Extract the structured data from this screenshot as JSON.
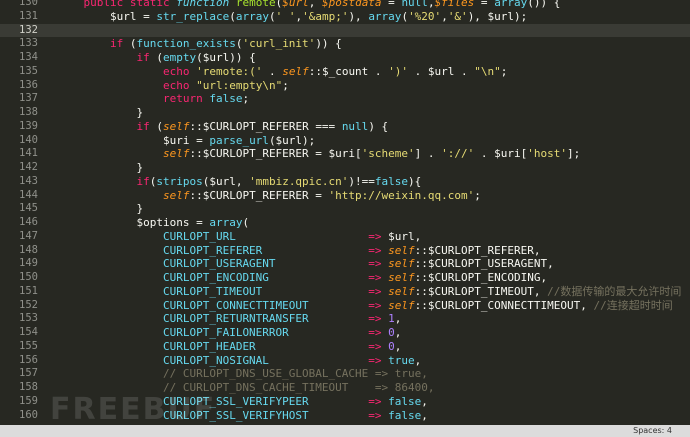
{
  "editor": {
    "lines": [
      {
        "num": "130",
        "tokens": [
          {
            "t": "    "
          },
          {
            "t": "public static ",
            "c": "kw"
          },
          {
            "t": "function ",
            "c": "st"
          },
          {
            "t": "remote",
            "c": "fn"
          },
          {
            "t": "("
          },
          {
            "t": "$url",
            "c": "var"
          },
          {
            "t": ", "
          },
          {
            "t": "$postdata",
            "c": "var"
          },
          {
            "t": " = "
          },
          {
            "t": "null",
            "c": "const"
          },
          {
            "t": ","
          },
          {
            "t": "$files",
            "c": "var"
          },
          {
            "t": " = "
          },
          {
            "t": "array",
            "c": "fb"
          },
          {
            "t": "()) {"
          }
        ]
      },
      {
        "num": "131",
        "tokens": [
          {
            "t": "        $url = "
          },
          {
            "t": "str_replace",
            "c": "fb"
          },
          {
            "t": "("
          },
          {
            "t": "array",
            "c": "fb"
          },
          {
            "t": "("
          },
          {
            "t": "' '",
            "c": "str"
          },
          {
            "t": ","
          },
          {
            "t": "'&amp;'",
            "c": "str"
          },
          {
            "t": "), "
          },
          {
            "t": "array",
            "c": "fb"
          },
          {
            "t": "("
          },
          {
            "t": "'%20'",
            "c": "str"
          },
          {
            "t": ","
          },
          {
            "t": "'&'",
            "c": "str"
          },
          {
            "t": "), $url);"
          }
        ]
      },
      {
        "num": "132",
        "current": true,
        "tokens": []
      },
      {
        "num": "133",
        "tokens": [
          {
            "t": "        "
          },
          {
            "t": "if",
            "c": "kw"
          },
          {
            "t": " ("
          },
          {
            "t": "function_exists",
            "c": "fb"
          },
          {
            "t": "("
          },
          {
            "t": "'curl_init'",
            "c": "str"
          },
          {
            "t": ")) {"
          }
        ]
      },
      {
        "num": "134",
        "tokens": [
          {
            "t": "            "
          },
          {
            "t": "if",
            "c": "kw"
          },
          {
            "t": " ("
          },
          {
            "t": "empty",
            "c": "fb"
          },
          {
            "t": "($url)) {"
          }
        ]
      },
      {
        "num": "135",
        "tokens": [
          {
            "t": "                "
          },
          {
            "t": "echo",
            "c": "kw"
          },
          {
            "t": " "
          },
          {
            "t": "'remote:('",
            "c": "str"
          },
          {
            "t": " . "
          },
          {
            "t": "self",
            "c": "self"
          },
          {
            "t": "::$_count . "
          },
          {
            "t": "')'",
            "c": "str"
          },
          {
            "t": " . $url . "
          },
          {
            "t": "\"\\n\"",
            "c": "str"
          },
          {
            "t": ";"
          }
        ]
      },
      {
        "num": "136",
        "tokens": [
          {
            "t": "                "
          },
          {
            "t": "echo",
            "c": "kw"
          },
          {
            "t": " "
          },
          {
            "t": "\"url:empty\\n\"",
            "c": "str"
          },
          {
            "t": ";"
          }
        ]
      },
      {
        "num": "137",
        "tokens": [
          {
            "t": "                "
          },
          {
            "t": "return",
            "c": "kw"
          },
          {
            "t": " "
          },
          {
            "t": "false",
            "c": "const"
          },
          {
            "t": ";"
          }
        ]
      },
      {
        "num": "138",
        "tokens": [
          {
            "t": "            }"
          }
        ]
      },
      {
        "num": "139",
        "tokens": [
          {
            "t": "            "
          },
          {
            "t": "if",
            "c": "kw"
          },
          {
            "t": " ("
          },
          {
            "t": "self",
            "c": "self"
          },
          {
            "t": "::$CURLOPT_REFERER === "
          },
          {
            "t": "null",
            "c": "const"
          },
          {
            "t": ") {"
          }
        ]
      },
      {
        "num": "140",
        "tokens": [
          {
            "t": "                $uri = "
          },
          {
            "t": "parse_url",
            "c": "fb"
          },
          {
            "t": "($url);"
          }
        ]
      },
      {
        "num": "141",
        "tokens": [
          {
            "t": "                "
          },
          {
            "t": "self",
            "c": "self"
          },
          {
            "t": "::$CURLOPT_REFERER = $uri["
          },
          {
            "t": "'scheme'",
            "c": "str"
          },
          {
            "t": "] . "
          },
          {
            "t": "'://'",
            "c": "str"
          },
          {
            "t": " . $uri["
          },
          {
            "t": "'host'",
            "c": "str"
          },
          {
            "t": "];"
          }
        ]
      },
      {
        "num": "142",
        "tokens": [
          {
            "t": "            }"
          }
        ]
      },
      {
        "num": "143",
        "tokens": [
          {
            "t": "            "
          },
          {
            "t": "if",
            "c": "kw"
          },
          {
            "t": "("
          },
          {
            "t": "stripos",
            "c": "fb"
          },
          {
            "t": "($url, "
          },
          {
            "t": "'mmbiz.qpic.cn'",
            "c": "str"
          },
          {
            "t": ")!=="
          },
          {
            "t": "false",
            "c": "const"
          },
          {
            "t": "){"
          }
        ]
      },
      {
        "num": "144",
        "tokens": [
          {
            "t": "                "
          },
          {
            "t": "self",
            "c": "self"
          },
          {
            "t": "::$CURLOPT_REFERER = "
          },
          {
            "t": "'http://weixin.qq.com'",
            "c": "str"
          },
          {
            "t": ";"
          }
        ]
      },
      {
        "num": "145",
        "tokens": [
          {
            "t": "            }"
          }
        ]
      },
      {
        "num": "146",
        "tokens": [
          {
            "t": "            $options = "
          },
          {
            "t": "array",
            "c": "fb"
          },
          {
            "t": "("
          }
        ]
      },
      {
        "num": "147",
        "tokens": [
          {
            "t": "                "
          },
          {
            "t": "CURLOPT_URL",
            "c": "const"
          },
          {
            "t": "                    "
          },
          {
            "t": "=>",
            "c": "op"
          },
          {
            "t": " $url,"
          }
        ]
      },
      {
        "num": "148",
        "tokens": [
          {
            "t": "                "
          },
          {
            "t": "CURLOPT_REFERER",
            "c": "const"
          },
          {
            "t": "                "
          },
          {
            "t": "=>",
            "c": "op"
          },
          {
            "t": " "
          },
          {
            "t": "self",
            "c": "self"
          },
          {
            "t": "::$CURLOPT_REFERER,"
          }
        ]
      },
      {
        "num": "149",
        "tokens": [
          {
            "t": "                "
          },
          {
            "t": "CURLOPT_USERAGENT",
            "c": "const"
          },
          {
            "t": "              "
          },
          {
            "t": "=>",
            "c": "op"
          },
          {
            "t": " "
          },
          {
            "t": "self",
            "c": "self"
          },
          {
            "t": "::$CURLOPT_USERAGENT,"
          }
        ]
      },
      {
        "num": "150",
        "tokens": [
          {
            "t": "                "
          },
          {
            "t": "CURLOPT_ENCODING",
            "c": "const"
          },
          {
            "t": "               "
          },
          {
            "t": "=>",
            "c": "op"
          },
          {
            "t": " "
          },
          {
            "t": "self",
            "c": "self"
          },
          {
            "t": "::$CURLOPT_ENCODING,"
          }
        ]
      },
      {
        "num": "151",
        "tokens": [
          {
            "t": "                "
          },
          {
            "t": "CURLOPT_TIMEOUT",
            "c": "const"
          },
          {
            "t": "                "
          },
          {
            "t": "=>",
            "c": "op"
          },
          {
            "t": " "
          },
          {
            "t": "self",
            "c": "self"
          },
          {
            "t": "::$CURLOPT_TIMEOUT, "
          },
          {
            "t": "//数据传输的最大允许时间",
            "c": "cm"
          }
        ]
      },
      {
        "num": "152",
        "tokens": [
          {
            "t": "                "
          },
          {
            "t": "CURLOPT_CONNECTTIMEOUT",
            "c": "const"
          },
          {
            "t": "         "
          },
          {
            "t": "=>",
            "c": "op"
          },
          {
            "t": " "
          },
          {
            "t": "self",
            "c": "self"
          },
          {
            "t": "::$CURLOPT_CONNECTTIMEOUT, "
          },
          {
            "t": "//连接超时时间",
            "c": "cm"
          }
        ]
      },
      {
        "num": "153",
        "tokens": [
          {
            "t": "                "
          },
          {
            "t": "CURLOPT_RETURNTRANSFER",
            "c": "const"
          },
          {
            "t": "         "
          },
          {
            "t": "=>",
            "c": "op"
          },
          {
            "t": " "
          },
          {
            "t": "1",
            "c": "num"
          },
          {
            "t": ","
          }
        ]
      },
      {
        "num": "154",
        "tokens": [
          {
            "t": "                "
          },
          {
            "t": "CURLOPT_FAILONERROR",
            "c": "const"
          },
          {
            "t": "            "
          },
          {
            "t": "=>",
            "c": "op"
          },
          {
            "t": " "
          },
          {
            "t": "0",
            "c": "num"
          },
          {
            "t": ","
          }
        ]
      },
      {
        "num": "155",
        "tokens": [
          {
            "t": "                "
          },
          {
            "t": "CURLOPT_HEADER",
            "c": "const"
          },
          {
            "t": "                 "
          },
          {
            "t": "=>",
            "c": "op"
          },
          {
            "t": " "
          },
          {
            "t": "0",
            "c": "num"
          },
          {
            "t": ","
          }
        ]
      },
      {
        "num": "156",
        "tokens": [
          {
            "t": "                "
          },
          {
            "t": "CURLOPT_NOSIGNAL",
            "c": "const"
          },
          {
            "t": "               "
          },
          {
            "t": "=>",
            "c": "op"
          },
          {
            "t": " "
          },
          {
            "t": "true",
            "c": "const"
          },
          {
            "t": ","
          }
        ]
      },
      {
        "num": "157",
        "tokens": [
          {
            "t": "                // CURLOPT_DNS_USE_GLOBAL_CACHE => true,",
            "c": "cm"
          }
        ]
      },
      {
        "num": "158",
        "tokens": [
          {
            "t": "                // CURLOPT_DNS_CACHE_TIMEOUT    => 86400,",
            "c": "cm"
          }
        ]
      },
      {
        "num": "159",
        "tokens": [
          {
            "t": "                "
          },
          {
            "t": "CURLOPT_SSL_VERIFYPEER",
            "c": "const"
          },
          {
            "t": "         "
          },
          {
            "t": "=>",
            "c": "op"
          },
          {
            "t": " "
          },
          {
            "t": "false",
            "c": "const"
          },
          {
            "t": ","
          }
        ]
      },
      {
        "num": "160",
        "tokens": [
          {
            "t": "                "
          },
          {
            "t": "CURLOPT_SSL_VERIFYHOST",
            "c": "const"
          },
          {
            "t": "         "
          },
          {
            "t": "=>",
            "c": "op"
          },
          {
            "t": " "
          },
          {
            "t": "false",
            "c": "const"
          },
          {
            "t": ","
          }
        ]
      }
    ]
  },
  "watermark": {
    "text": "FREEBUF"
  },
  "status_bar": {
    "indentation": "Spaces: 4"
  },
  "colors": {
    "background": "#272822",
    "keyword": "#f92672",
    "function": "#a6e22e",
    "builtin": "#66d9ef",
    "variable": "#fd971f",
    "string": "#e6db74",
    "number": "#ae81ff",
    "comment": "#75715e"
  }
}
